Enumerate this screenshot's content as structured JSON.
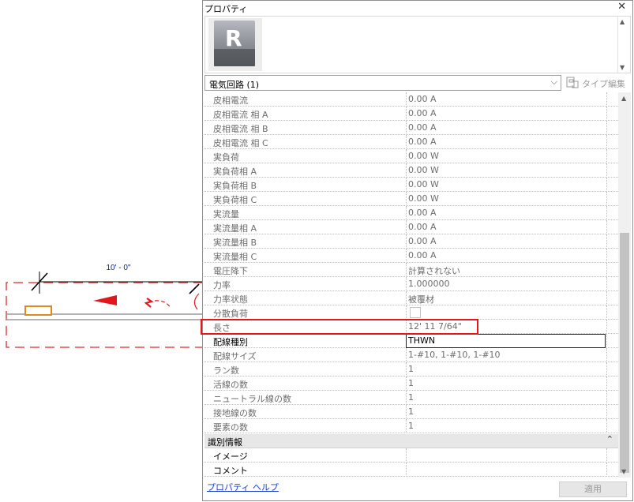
{
  "canvas": {
    "dimension_text": "10' - 0\""
  },
  "panel": {
    "title": "プロパティ",
    "close_label": "✕",
    "preview_logo_letter": "R",
    "type_selector": {
      "value": "電気回路 (1)",
      "chevron": "⌵"
    },
    "edit_type_label": "タイプ編集",
    "rows": [
      {
        "name": "皮相電流",
        "value": "0.00 A"
      },
      {
        "name": "皮相電流 相 A",
        "value": "0.00 A"
      },
      {
        "name": "皮相電流 相 B",
        "value": "0.00 A"
      },
      {
        "name": "皮相電流 相 C",
        "value": "0.00 A"
      },
      {
        "name": "実負荷",
        "value": "0.00 W"
      },
      {
        "name": "実負荷相 A",
        "value": "0.00 W"
      },
      {
        "name": "実負荷相 B",
        "value": "0.00 W"
      },
      {
        "name": "実負荷相 C",
        "value": "0.00 W"
      },
      {
        "name": "実流量",
        "value": "0.00 A"
      },
      {
        "name": "実流量相 A",
        "value": "0.00 A"
      },
      {
        "name": "実流量相 B",
        "value": "0.00 A"
      },
      {
        "name": "実流量相 C",
        "value": "0.00 A"
      },
      {
        "name": "電圧降下",
        "value": "計算されない"
      },
      {
        "name": "力率",
        "value": "1.000000"
      },
      {
        "name": "力率状態",
        "value": "被覆材"
      },
      {
        "name": "分散負荷",
        "value": ""
      },
      {
        "name": "長さ",
        "value": "12'  11 7/64\""
      },
      {
        "name": "配線種別",
        "value": "THWN"
      },
      {
        "name": "配線サイズ",
        "value": "1-#10, 1-#10, 1-#10"
      },
      {
        "name": "ラン数",
        "value": "1"
      },
      {
        "name": "活線の数",
        "value": "1"
      },
      {
        "name": "ニュートラル線の数",
        "value": "1"
      },
      {
        "name": "接地線の数",
        "value": "1"
      },
      {
        "name": "要素の数",
        "value": "1"
      }
    ],
    "group": {
      "name": "識別情報",
      "toggle": "⌃"
    },
    "group_rows": [
      {
        "name": "イメージ",
        "value": ""
      },
      {
        "name": "コメント",
        "value": ""
      }
    ],
    "help_link": "プロパティ ヘルプ",
    "apply_label": "適用",
    "highlight_color": "#e5161c"
  }
}
